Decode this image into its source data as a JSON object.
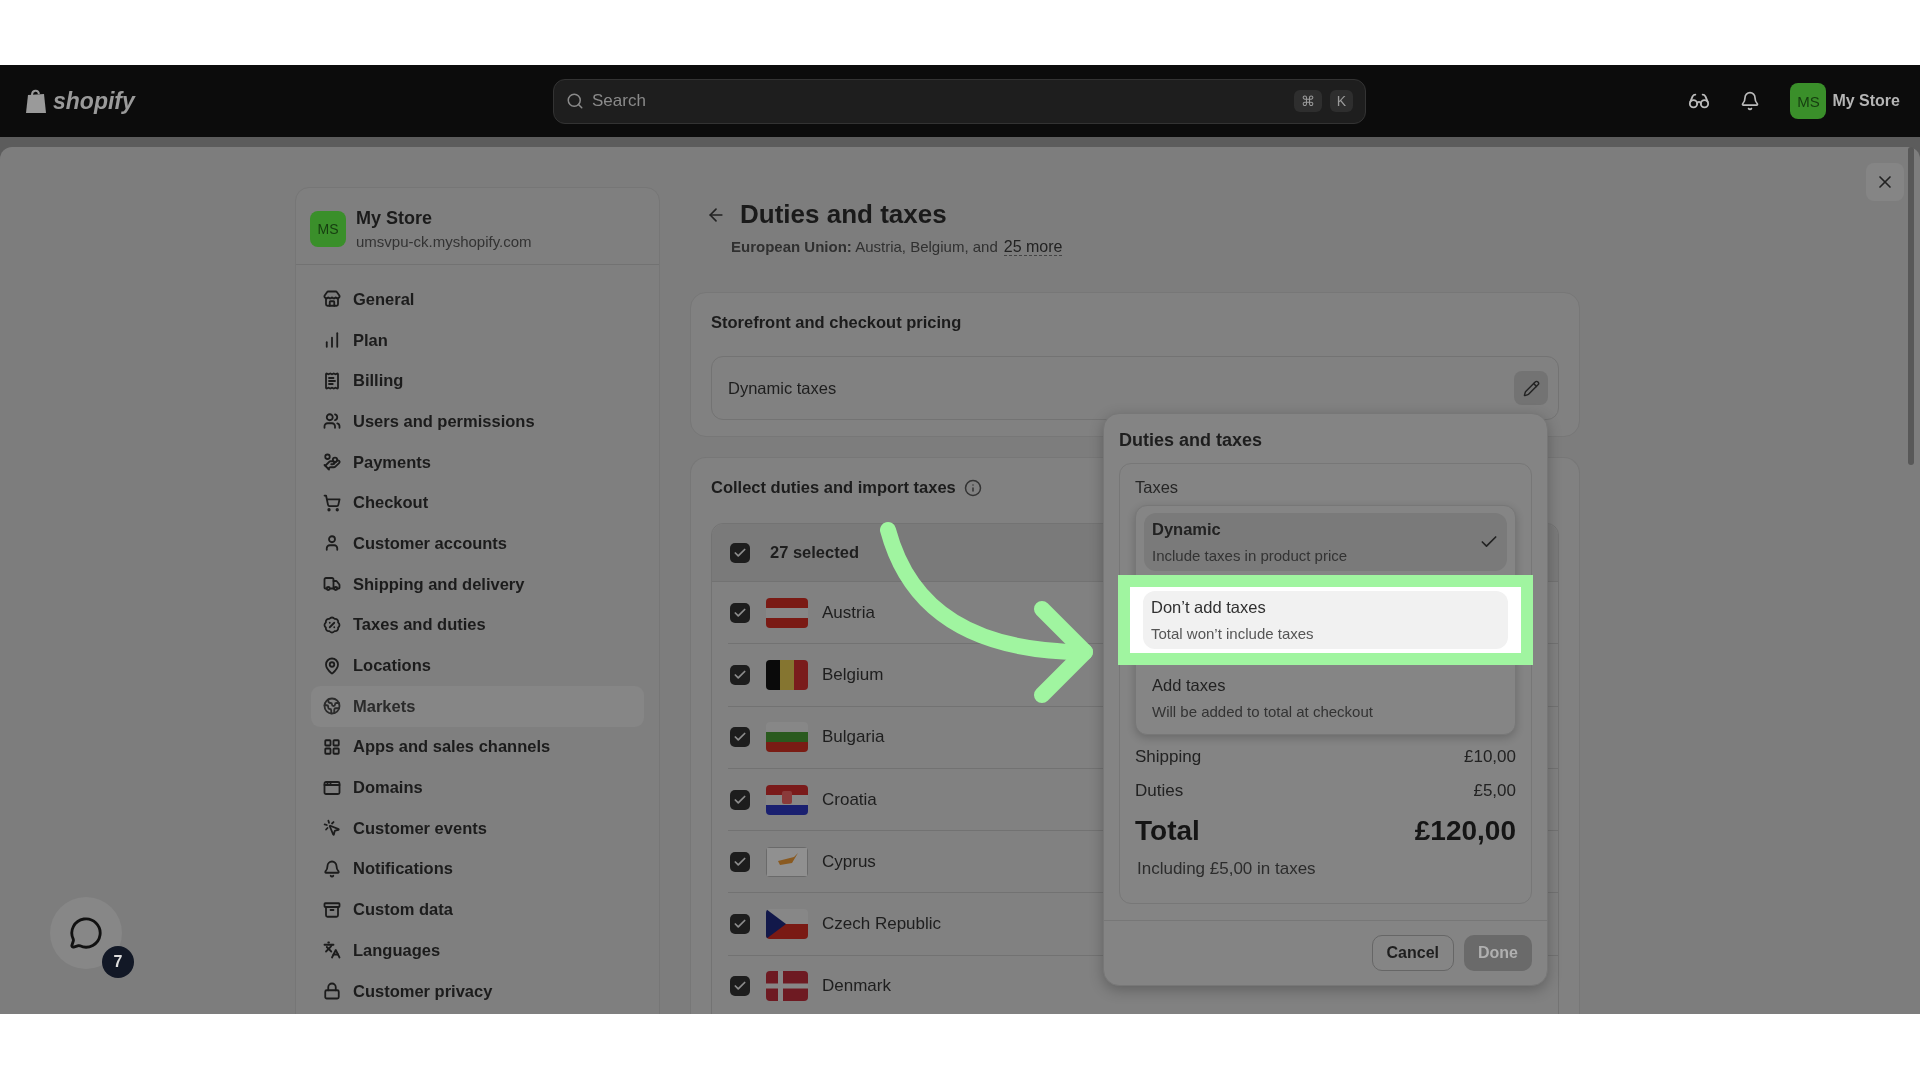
{
  "top_bar": {
    "logo": "shopify",
    "search": {
      "placeholder": "Search",
      "keys": [
        "⌘",
        "K"
      ]
    },
    "account": {
      "initials": "MS",
      "name": "My Store"
    }
  },
  "sidebar": {
    "store": {
      "initials": "MS",
      "name": "My Store",
      "domain": "umsvpu-ck.myshopify.com"
    },
    "items": [
      {
        "label": "General",
        "selected": false
      },
      {
        "label": "Plan",
        "selected": false
      },
      {
        "label": "Billing",
        "selected": false
      },
      {
        "label": "Users and permissions",
        "selected": false
      },
      {
        "label": "Payments",
        "selected": false
      },
      {
        "label": "Checkout",
        "selected": false
      },
      {
        "label": "Customer accounts",
        "selected": false
      },
      {
        "label": "Shipping and delivery",
        "selected": false
      },
      {
        "label": "Taxes and duties",
        "selected": false
      },
      {
        "label": "Locations",
        "selected": false
      },
      {
        "label": "Markets",
        "selected": true
      },
      {
        "label": "Apps and sales channels",
        "selected": false
      },
      {
        "label": "Domains",
        "selected": false
      },
      {
        "label": "Customer events",
        "selected": false
      },
      {
        "label": "Notifications",
        "selected": false
      },
      {
        "label": "Custom data",
        "selected": false
      },
      {
        "label": "Languages",
        "selected": false
      },
      {
        "label": "Customer privacy",
        "selected": false
      }
    ]
  },
  "page": {
    "title": "Duties and taxes",
    "subtitle": {
      "label": "European Union:",
      "text": "Austria, Belgium, and",
      "link": "25 more"
    }
  },
  "pricing_card": {
    "title": "Storefront and checkout pricing",
    "value": "Dynamic taxes"
  },
  "duties_card": {
    "title": "Collect duties and import taxes",
    "select_all": {
      "label": "27 selected",
      "checked": true
    },
    "countries": [
      {
        "name": "Austria",
        "checked": true
      },
      {
        "name": "Belgium",
        "checked": true
      },
      {
        "name": "Bulgaria",
        "checked": true
      },
      {
        "name": "Croatia",
        "checked": true
      },
      {
        "name": "Cyprus",
        "checked": true
      },
      {
        "name": "Czech Republic",
        "checked": true
      },
      {
        "name": "Denmark",
        "checked": true
      }
    ]
  },
  "popover": {
    "title": "Duties and taxes",
    "field_label": "Taxes",
    "options": [
      {
        "title": "Dynamic",
        "description": "Include taxes in product price",
        "selected": true,
        "hovered": false
      },
      {
        "title": "Don’t add taxes",
        "description": "Total won’t include taxes",
        "selected": false,
        "hovered": true
      },
      {
        "title": "Add taxes",
        "description": "Will be added to total at checkout",
        "selected": false,
        "hovered": false
      }
    ],
    "summary": [
      {
        "label": "Shipping",
        "value": "£10,00"
      },
      {
        "label": "Duties",
        "value": "£5,00"
      }
    ],
    "total": {
      "label": "Total",
      "value": "£120,00"
    },
    "note": "Including £5,00 in taxes",
    "buttons": [
      {
        "label": "Cancel",
        "disabled": false
      },
      {
        "label": "Done",
        "disabled": true
      }
    ]
  },
  "help_badge": {
    "count": "7"
  }
}
